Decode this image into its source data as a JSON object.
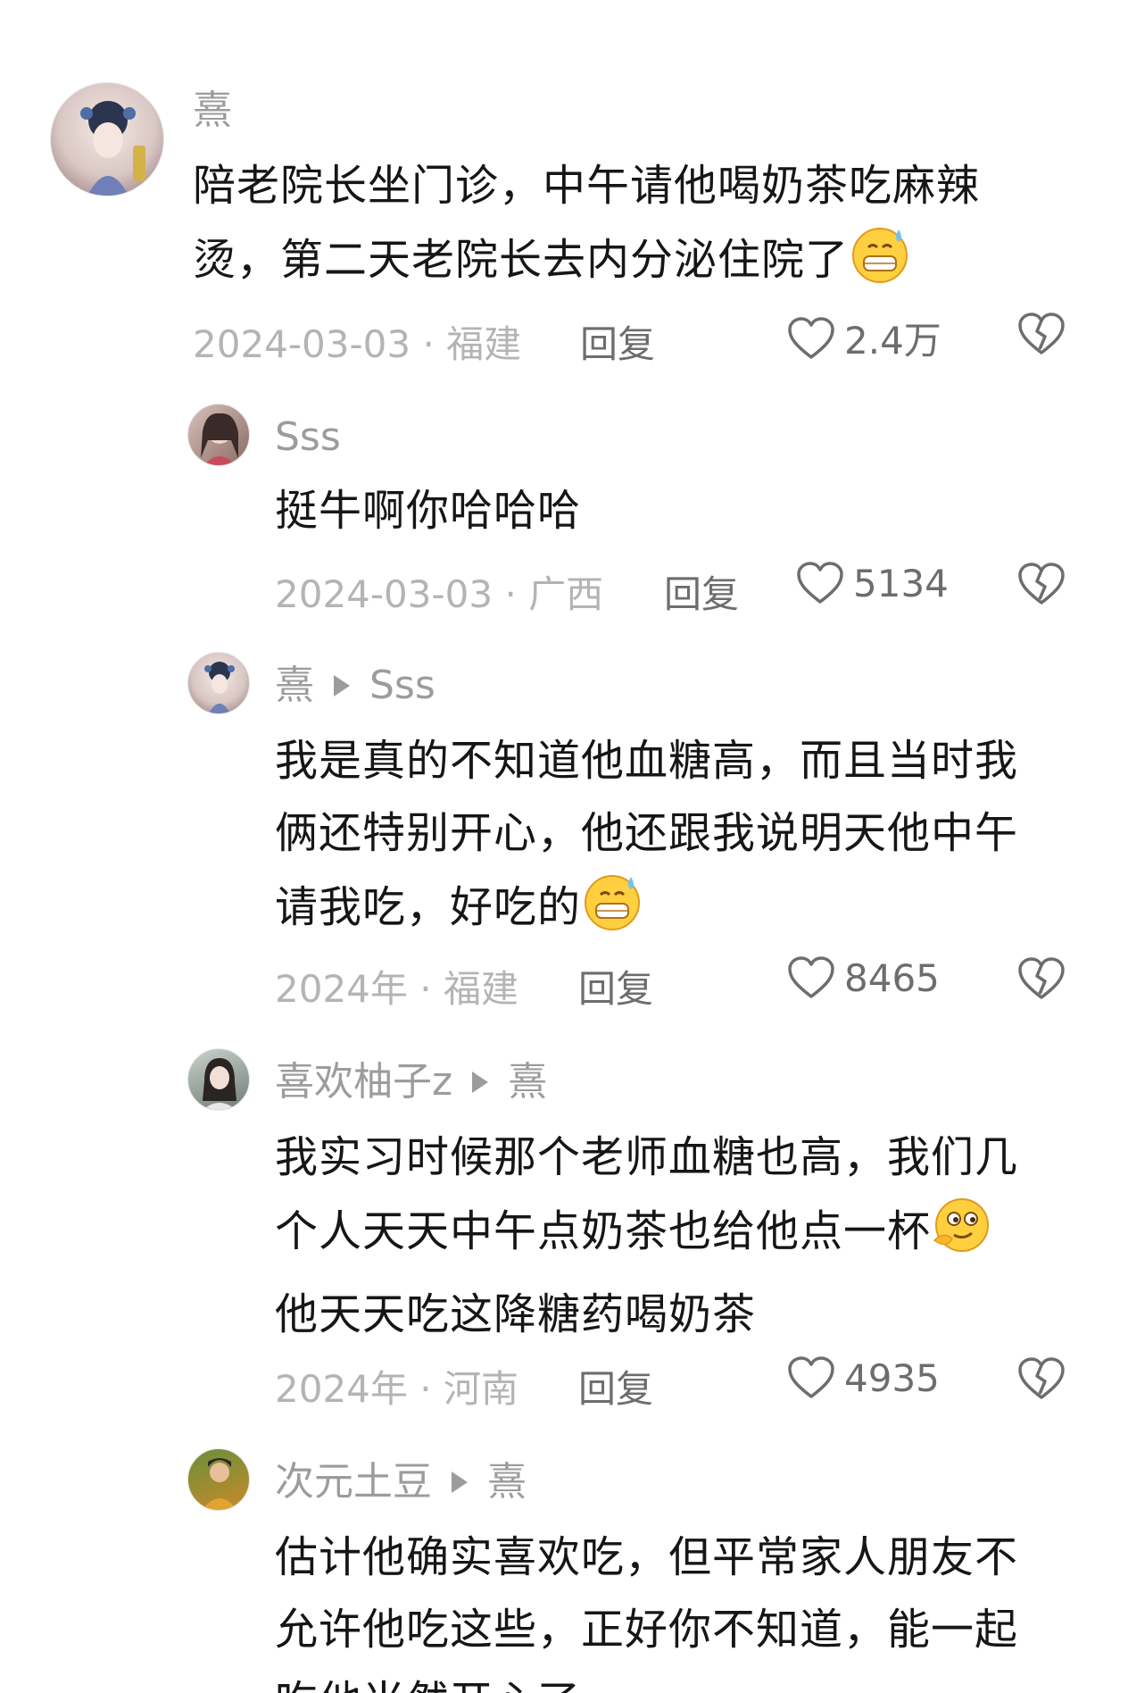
{
  "comments": [
    {
      "user": "熹",
      "text_lines": [
        "陪老院长坐门诊，中午请他喝奶茶吃麻辣",
        "烫，第二天老院长去内分泌住院了"
      ],
      "emoji": "grimace-sweat-emoji",
      "date": "2024-03-03",
      "location": "福建",
      "reply_label": "回复",
      "likes": "2.4万"
    },
    {
      "user": "Sss",
      "text_lines": [
        "挺牛啊你哈哈哈"
      ],
      "date": "2024-03-03",
      "location": "广西",
      "reply_label": "回复",
      "likes": "5134"
    },
    {
      "user": "熹",
      "reply_to": "Sss",
      "text_lines": [
        "我是真的不知道他血糖高，而且当时我",
        "俩还特别开心，他还跟我说明天他中午",
        "请我吃，好吃的"
      ],
      "emoji": "grimace-sweat-emoji",
      "date": "2024年",
      "location": "福建",
      "reply_label": "回复",
      "likes": "8465"
    },
    {
      "user": "喜欢柚子z",
      "reply_to": "熹",
      "text_lines": [
        "我实习时候那个老师血糖也高，我们几",
        "个人天天中午点奶茶也给他点一杯",
        "他天天吃这降糖药喝奶茶"
      ],
      "emoji": "thinking-smirk-emoji",
      "date": "2024年",
      "location": "河南",
      "reply_label": "回复",
      "likes": "4935"
    },
    {
      "user": "次元土豆",
      "reply_to": "熹",
      "text_lines": [
        "估计他确实喜欢吃，但平常家人朋友不",
        "允许他吃这些，正好你不知道，能一起",
        "吃他当然开心了"
      ]
    }
  ],
  "dot_separator": "·"
}
